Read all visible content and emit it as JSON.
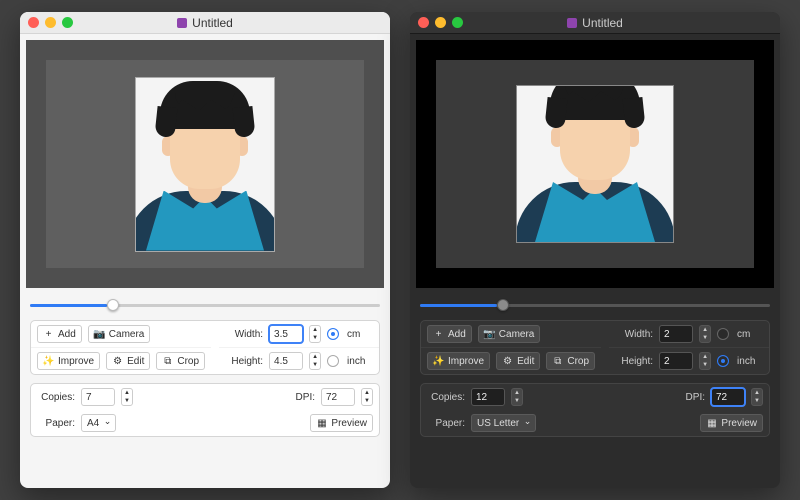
{
  "light": {
    "title": "Untitled",
    "slider_percent": 22,
    "buttons": {
      "add": "Add",
      "camera": "Camera",
      "improve": "Improve",
      "edit": "Edit",
      "crop": "Crop",
      "preview": "Preview"
    },
    "size": {
      "width_label": "Width:",
      "width_value": "3.5",
      "height_label": "Height:",
      "height_value": "4.5",
      "unit_cm": "cm",
      "unit_inch": "inch",
      "unit_selected": "cm"
    },
    "print": {
      "copies_label": "Copies:",
      "copies_value": "7",
      "paper_label": "Paper:",
      "paper_value": "A4",
      "dpi_label": "DPI:",
      "dpi_value": "72"
    }
  },
  "dark": {
    "title": "Untitled",
    "slider_percent": 22,
    "buttons": {
      "add": "Add",
      "camera": "Camera",
      "improve": "Improve",
      "edit": "Edit",
      "crop": "Crop",
      "preview": "Preview"
    },
    "size": {
      "width_label": "Width:",
      "width_value": "2",
      "height_label": "Height:",
      "height_value": "2",
      "unit_cm": "cm",
      "unit_inch": "inch",
      "unit_selected": "inch"
    },
    "print": {
      "copies_label": "Copies:",
      "copies_value": "12",
      "paper_label": "Paper:",
      "paper_value": "US Letter",
      "dpi_label": "DPI:",
      "dpi_value": "72"
    }
  }
}
